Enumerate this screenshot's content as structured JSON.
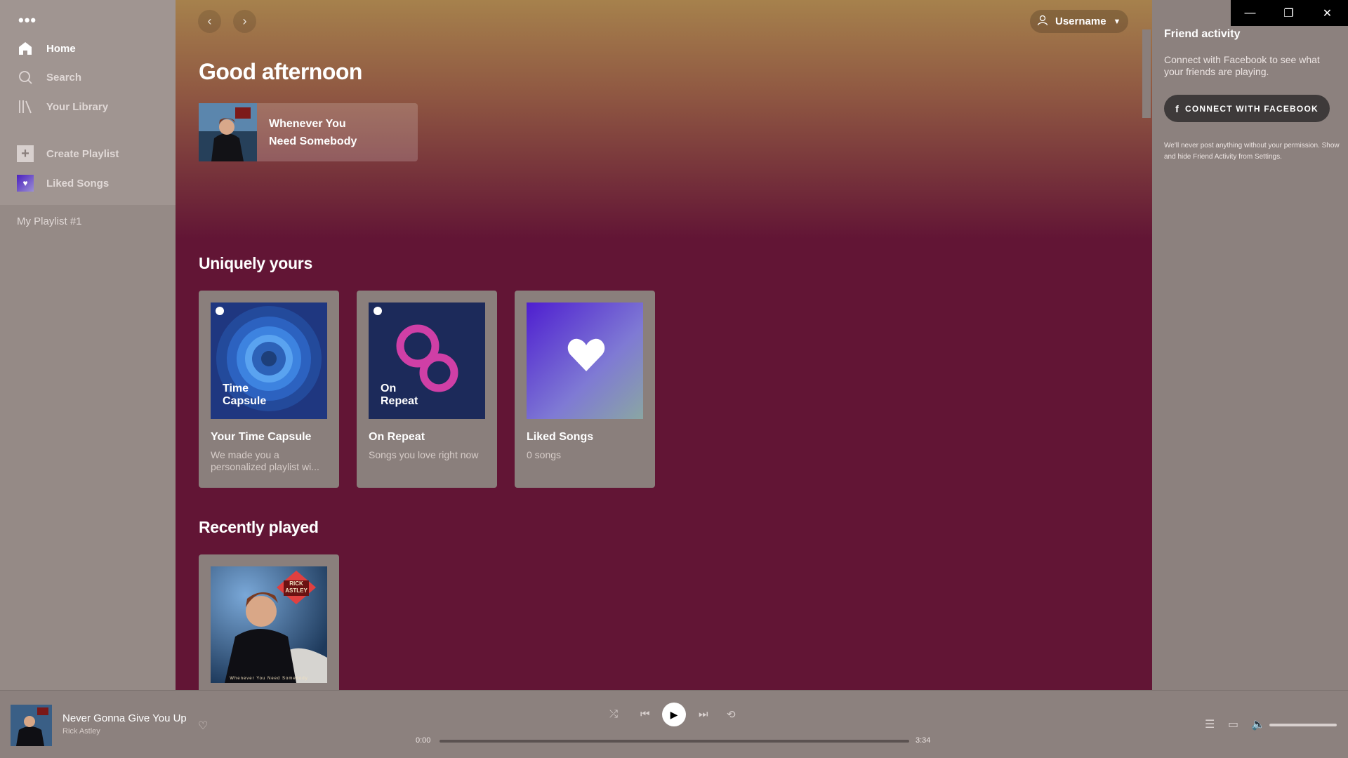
{
  "sidebar": {
    "menu_dots": "•••",
    "nav": [
      {
        "label": "Home",
        "icon": "home-icon"
      },
      {
        "label": "Search",
        "icon": "search-icon"
      },
      {
        "label": "Your Library",
        "icon": "library-icon"
      }
    ],
    "actions": [
      {
        "label": "Create Playlist",
        "icon": "plus-icon"
      },
      {
        "label": "Liked Songs",
        "icon": "heart-icon"
      }
    ],
    "playlists": [
      "My Playlist #1"
    ]
  },
  "header": {
    "username": "Username"
  },
  "main": {
    "greeting": "Good afternoon",
    "quick_card": {
      "title_line1": "Whenever You",
      "title_line2": "Need Somebody"
    },
    "sections": [
      {
        "title": "Uniquely yours",
        "cards": [
          {
            "title": "Your Time Capsule",
            "subtitle": "We made you a personalized playlist wi...",
            "art_label_line1": "Time",
            "art_label_line2": "Capsule"
          },
          {
            "title": "On Repeat",
            "subtitle": "Songs you love right now",
            "art_label_line1": "On",
            "art_label_line2": "Repeat"
          },
          {
            "title": "Liked Songs",
            "subtitle": "0 songs"
          }
        ]
      },
      {
        "title": "Recently played",
        "cards": [
          {
            "art_text_top": "RICK",
            "art_text_name": "ASTLEY",
            "art_caption": "Whenever You Need Somebody"
          }
        ]
      }
    ]
  },
  "friend_activity": {
    "title": "Friend activity",
    "text": "Connect with Facebook to see what your friends are playing.",
    "button": "CONNECT WITH FACEBOOK",
    "button_icon": "f",
    "note": "We'll never post anything without your permission. Show and hide Friend Activity from Settings."
  },
  "window": {
    "minimize": "—",
    "restore": "❐",
    "close": "✕"
  },
  "player": {
    "track_title": "Never Gonna Give You Up",
    "artist": "Rick Astley",
    "time_current": "0:00",
    "time_total": "3:34",
    "progress": 0.0,
    "volume": 1.0
  },
  "colors": {
    "main_bg": "#621535",
    "header_top": "#a6814c",
    "sidebar": "#958a86",
    "card": "#8a7f7c"
  }
}
